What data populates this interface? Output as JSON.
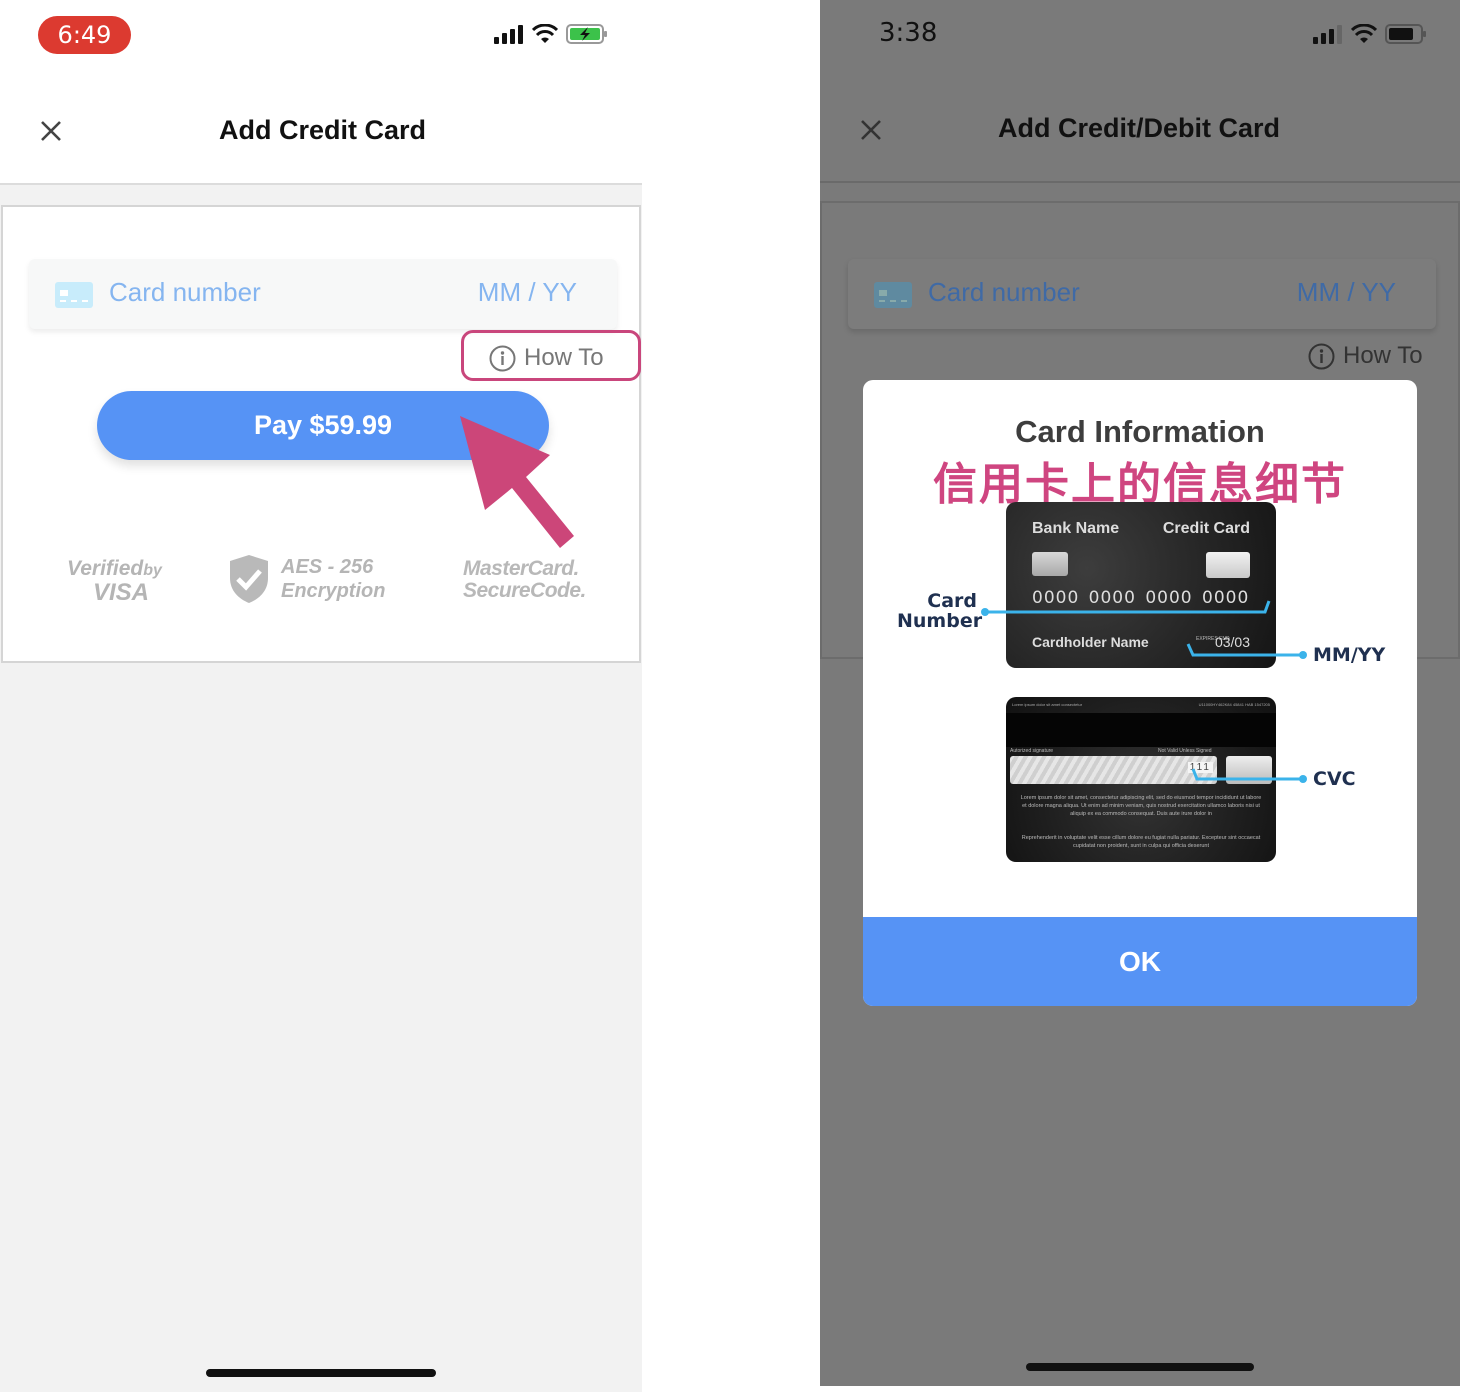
{
  "left_screen": {
    "status_bar": {
      "time": "6:49",
      "time_pill_color": "#dc3a30",
      "icons": [
        "cellular-signal-icon",
        "wifi-icon",
        "battery-charging-icon"
      ]
    },
    "navbar": {
      "title": "Add Credit Card",
      "close_icon": "close-icon"
    },
    "card_input": {
      "card_number_placeholder": "Card number",
      "expiry_placeholder": "MM / YY",
      "icon": "credit-card-icon"
    },
    "how_to_label": "How To",
    "pay_button_label": "Pay $59.99",
    "trust_badges": {
      "visa_line1": "Verified",
      "visa_by": "by",
      "visa_line2": "VISA",
      "aes_line1": "AES - 256",
      "aes_line2": "Encryption",
      "mastercard_line1": "MasterCard.",
      "mastercard_line2": "SecureCode."
    },
    "annotation_color": "#c9467c"
  },
  "right_screen": {
    "status_bar": {
      "time": "3:38",
      "icons": [
        "cellular-signal-icon",
        "wifi-icon",
        "battery-icon"
      ]
    },
    "navbar": {
      "title": "Add Credit/Debit Card",
      "close_icon": "close-icon"
    },
    "card_input": {
      "card_number_placeholder": "Card number",
      "expiry_placeholder": "MM / YY"
    },
    "how_to_label": "How To",
    "modal": {
      "title": "Card Information",
      "subtitle": "信用卡上的信息细节",
      "card_front": {
        "bank_name": "Bank Name",
        "card_type": "Credit Card",
        "number": "0000 0000 0000 0000",
        "holder": "Cardholder Name",
        "expires_label": "EXPIRES END",
        "expiry": "03/03"
      },
      "card_back": {
        "top_text": "Lorem ipsum dolor sit amet consectetur",
        "top_code": "U11000HY462K84 45841 HAB 1547205",
        "signature_label": "Autorized signature",
        "not_valid_label": "Not Valid Unless Signed",
        "cvc_value": "111",
        "lorem_1": "Lorem ipsum dolor sit amet, consectetur adipiscing elit, sed do eiusmod tempor incididunt ut labore et dolore magna aliqua. Ut enim ad minim veniam, quis nostrud exercitation ullamco laboris nisi ut aliquip ex ea commodo consequat. Duis aute irure dolor in",
        "lorem_2": "Reprehenderit in voluptate velit esse cillum dolore eu fugiat nulla pariatur. Excepteur sint occaecat cupidatat non proident, sunt in culpa qui officia deserunt"
      },
      "callouts": {
        "card_number_line1": "Card",
        "card_number_line2": "Number",
        "expiry": "MM/YY",
        "cvc": "CVC"
      },
      "ok_label": "OK"
    }
  },
  "colors": {
    "primary_blue": "#5693f5",
    "placeholder_blue": "#85b5f0",
    "highlight_pink": "#cf4580",
    "callout_blue": "#3bb3ea",
    "overlay_gray": "#7a7a7a"
  }
}
